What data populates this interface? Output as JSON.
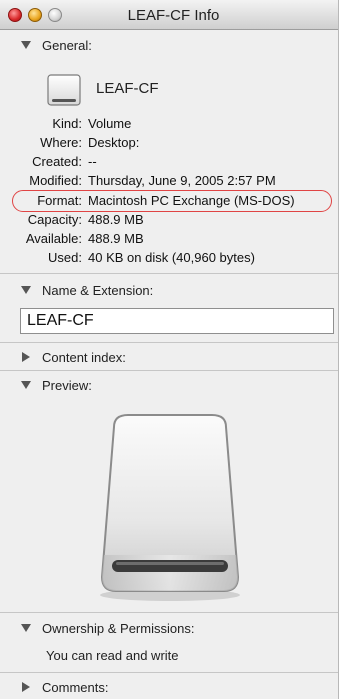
{
  "window": {
    "title": "LEAF-CF Info"
  },
  "general": {
    "header": "General:",
    "volume_name": "LEAF-CF",
    "rows": [
      {
        "key": "Kind:",
        "value": "Volume"
      },
      {
        "key": "Where:",
        "value": "Desktop:"
      },
      {
        "key": "Created:",
        "value": "--"
      },
      {
        "key": "Modified:",
        "value": "Thursday, June 9, 2005 2:57 PM"
      },
      {
        "key": "Format:",
        "value": "Macintosh PC Exchange (MS-DOS)"
      },
      {
        "key": "Capacity:",
        "value": "488.9 MB"
      },
      {
        "key": "Available:",
        "value": "488.9 MB"
      },
      {
        "key": "Used:",
        "value": "40 KB on disk (40,960 bytes)"
      }
    ]
  },
  "name_extension": {
    "header": "Name & Extension:",
    "value": "LEAF-CF"
  },
  "content_index": {
    "header": "Content index:"
  },
  "preview": {
    "header": "Preview:"
  },
  "ownership": {
    "header": "Ownership & Permissions:",
    "text": "You can read and write"
  },
  "comments": {
    "header": "Comments:"
  },
  "colors": {
    "highlight_oval": "#e04444",
    "background": "#efefef"
  },
  "icons": {
    "close": "close-icon",
    "minimize": "minimize-icon",
    "zoom": "zoom-icon",
    "expanded": "disclosure-down-icon",
    "collapsed": "disclosure-right-icon",
    "volume": "external-drive-icon"
  }
}
